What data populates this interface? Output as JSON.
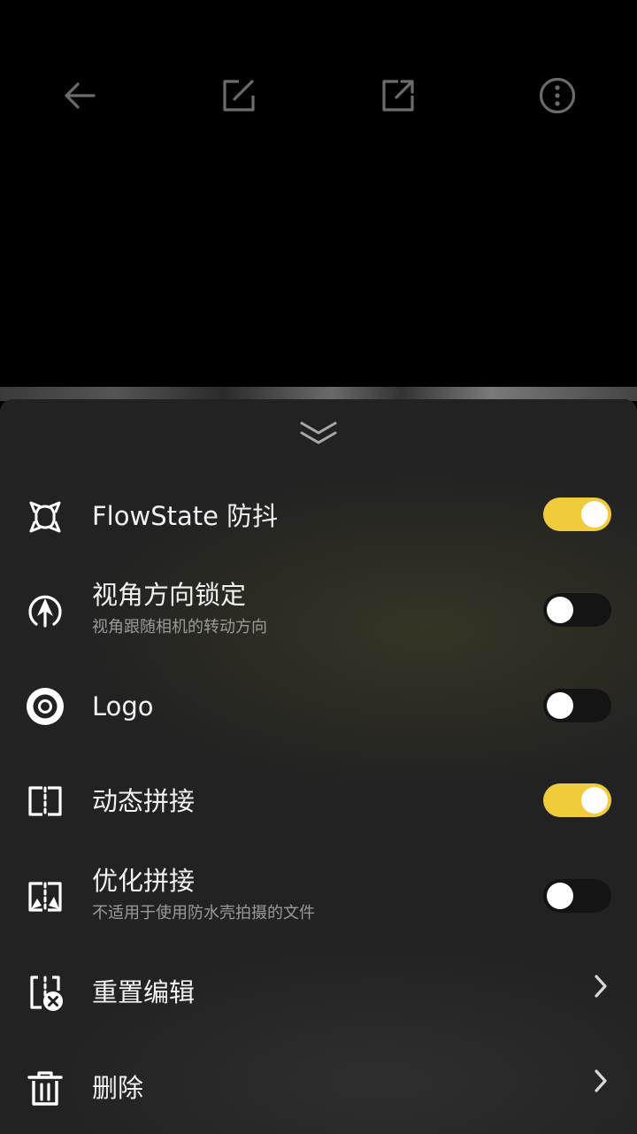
{
  "toolbar": {
    "back_icon": "arrow-left-icon",
    "edit_icon": "edit-square-icon",
    "share_icon": "export-icon",
    "more_icon": "more-vertical-circle-icon"
  },
  "sheet": {
    "collapse_icon": "double-chevron-down-icon",
    "items": [
      {
        "label": "FlowState 防抖",
        "subtitle": "",
        "icon": "stabilization-icon",
        "control": "toggle",
        "on": true
      },
      {
        "label": "视角方向锁定",
        "subtitle": "视角跟随相机的转动方向",
        "icon": "direction-lock-icon",
        "control": "toggle",
        "on": false
      },
      {
        "label": "Logo",
        "subtitle": "",
        "icon": "logo-icon",
        "control": "toggle",
        "on": false
      },
      {
        "label": "动态拼接",
        "subtitle": "",
        "icon": "dynamic-stitch-icon",
        "control": "toggle",
        "on": true
      },
      {
        "label": "优化拼接",
        "subtitle": "不适用于使用防水壳拍摄的文件",
        "icon": "optimize-stitch-icon",
        "control": "toggle",
        "on": false
      },
      {
        "label": "重置编辑",
        "subtitle": "",
        "icon": "reset-edit-icon",
        "control": "chevron"
      },
      {
        "label": "删除",
        "subtitle": "",
        "icon": "trash-icon",
        "control": "chevron"
      }
    ]
  },
  "colors": {
    "toggle_on": "#f0cb3c",
    "toggle_off": "#141414",
    "sheet_bg": "#222222",
    "text_primary": "#f2f2f2",
    "text_secondary": "#9a9a9a"
  }
}
